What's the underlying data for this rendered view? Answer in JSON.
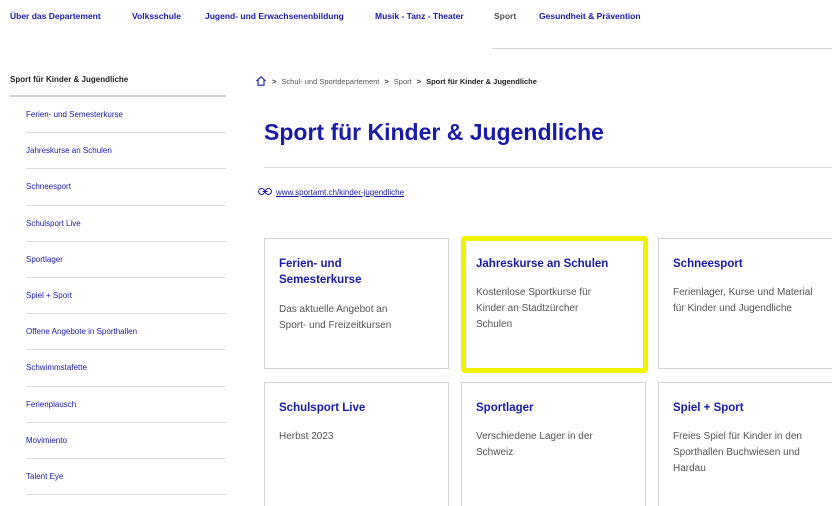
{
  "topnav": {
    "items": [
      "Über das Departement",
      "Volksschule",
      "Jugend- und Erwachsenenbildung",
      "Musik - Tanz - Theater",
      "Sport",
      "Gesundheit & Prävention"
    ]
  },
  "sidebar": {
    "heading": "Sport für Kinder & Jugendliche",
    "items": [
      "Ferien- und Semesterkurse",
      "Jahreskurse an Schulen",
      "Schneesport",
      "Schulsport Live",
      "Sportlager",
      "Spiel + Sport",
      "Offene Angebote in Sporthallen",
      "Schwimmstafette",
      "Ferienplausch",
      "Movimiento",
      "Talent Eye"
    ]
  },
  "breadcrumb": {
    "items": [
      "Schul- und Sportdepartement",
      "Sport",
      "Sport für Kinder & Jugendliche"
    ],
    "separator": ">"
  },
  "page": {
    "title": "Sport für Kinder & Jugendliche",
    "link_text": "www.sportamt.ch/kinder-jugendliche"
  },
  "cards": [
    {
      "title1": "Ferien- und",
      "title2": "Semesterkurse",
      "desc1": "Das aktuelle Angebot an",
      "desc2": "Sport- und Freizeitkursen",
      "desc3": ""
    },
    {
      "title1": "Jahreskurse an Schulen",
      "title2": "",
      "desc1": "Kostenlose Sportkurse für",
      "desc2": "Kinder an Stadtzürcher",
      "desc3": "Schulen"
    },
    {
      "title1": "Schneesport",
      "title2": "",
      "desc1": "Ferienlager, Kurse und Material",
      "desc2": "für Kinder und Jugendliche",
      "desc3": ""
    },
    {
      "title1": "Schulsport Live",
      "title2": "",
      "desc1": "Herbst 2023",
      "desc2": "",
      "desc3": ""
    },
    {
      "title1": "Sportlager",
      "title2": "",
      "desc1": "Verschiedene Lager in der",
      "desc2": "Schweiz",
      "desc3": ""
    },
    {
      "title1": "Spiel + Sport",
      "title2": "",
      "desc1": "Freies Spiel für Kinder in den",
      "desc2": "Sporthallen Buchwiesen und",
      "desc3": "Hardau"
    }
  ],
  "colors": {
    "brand_blue": "#1a1aa8",
    "highlight": "#f2f200"
  }
}
